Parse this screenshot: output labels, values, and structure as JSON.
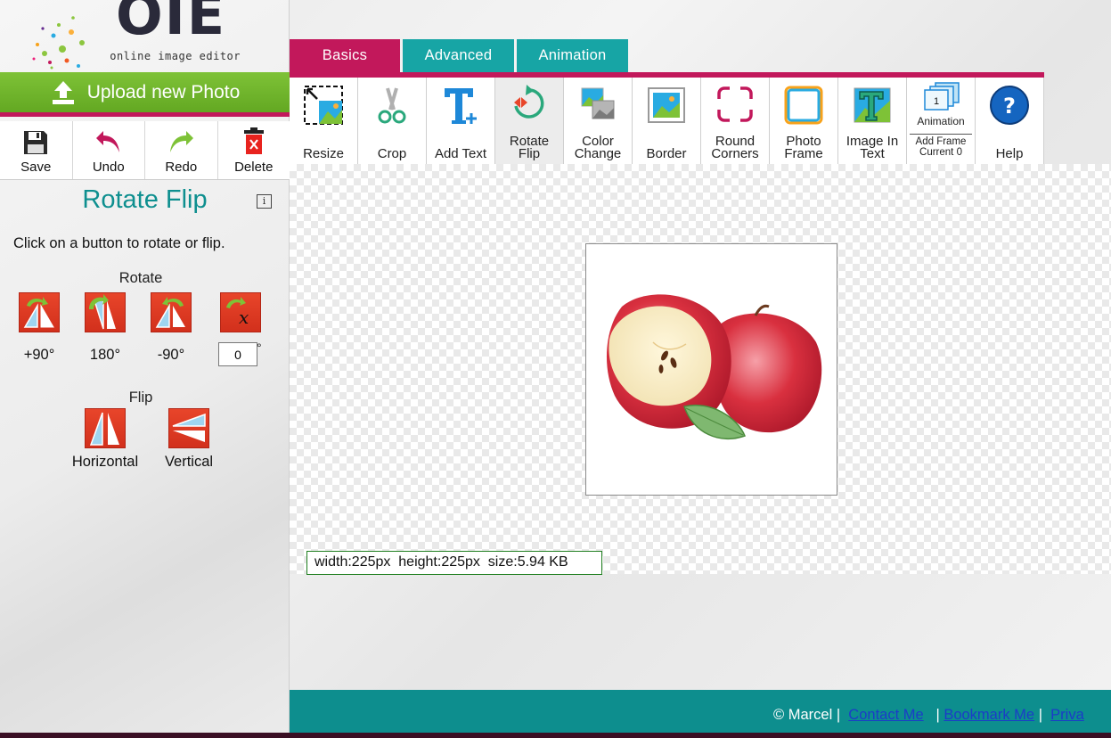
{
  "logo": {
    "wordmark": "OIE",
    "tagline": "online image editor"
  },
  "sidebar": {
    "upload_label": "Upload new Photo",
    "actions": [
      {
        "label": "Save",
        "icon": "floppy-disk-icon"
      },
      {
        "label": "Undo",
        "icon": "undo-arrow-icon"
      },
      {
        "label": "Redo",
        "icon": "redo-arrow-icon"
      },
      {
        "label": "Delete",
        "icon": "trash-icon"
      }
    ],
    "panel_title": "Rotate Flip",
    "info_icon": "i",
    "instructions": "Click on a button to rotate or flip.",
    "rotate_heading": "Rotate",
    "rotate_buttons": [
      {
        "label": "+90°",
        "icon": "rotate-plus-90-icon"
      },
      {
        "label": "180°",
        "icon": "rotate-180-icon"
      },
      {
        "label": "-90°",
        "icon": "rotate-minus-90-icon"
      }
    ],
    "custom_angle": {
      "value": "0",
      "degree_symbol": "°",
      "icon": "rotate-custom-icon"
    },
    "flip_heading": "Flip",
    "flip_buttons": [
      {
        "label": "Horizontal",
        "icon": "flip-horizontal-icon"
      },
      {
        "label": "Vertical",
        "icon": "flip-vertical-icon"
      }
    ]
  },
  "tabs": [
    {
      "label": "Basics",
      "active": true
    },
    {
      "label": "Advanced",
      "active": false
    },
    {
      "label": "Animation",
      "active": false
    }
  ],
  "toolbar": {
    "tools": [
      {
        "label": "Resize",
        "icon": "resize-icon"
      },
      {
        "label": "Crop",
        "icon": "scissors-icon"
      },
      {
        "label": "Add Text",
        "icon": "add-text-icon"
      },
      {
        "label_line1": "Rotate",
        "label_line2": "Flip",
        "icon": "rotate-flip-icon",
        "active": true
      },
      {
        "label_line1": "Color",
        "label_line2": "Change",
        "icon": "color-change-icon"
      },
      {
        "label": "Border",
        "icon": "border-icon"
      },
      {
        "label_line1": "Round",
        "label_line2": "Corners",
        "icon": "round-corners-icon"
      },
      {
        "label_line1": "Photo",
        "label_line2": "Frame",
        "icon": "photo-frame-icon"
      },
      {
        "label_line1": "Image In",
        "label_line2": "Text",
        "icon": "image-in-text-icon"
      },
      {
        "label": "Help",
        "icon": "help-icon"
      }
    ],
    "animation_tool": {
      "label": "Animation",
      "frame_number": "1",
      "add_frame_label": "Add Frame",
      "current_label": "Current 0",
      "icon": "animation-frames-icon"
    }
  },
  "canvas": {
    "image_description_icon": "apple-photo",
    "size_info": "width:225px  height:225px  size:5.94 KB"
  },
  "footer": {
    "copyright": "© Marcel |",
    "links": [
      "Contact Me",
      "Bookmark Me",
      "Priva"
    ],
    "separator": "|"
  },
  "colors": {
    "accent_magenta": "#c2185b",
    "accent_teal": "#17a5a5",
    "upload_green": "#7ec237",
    "footer_teal": "#0d8e8e",
    "title_teal": "#0e8f8f"
  }
}
